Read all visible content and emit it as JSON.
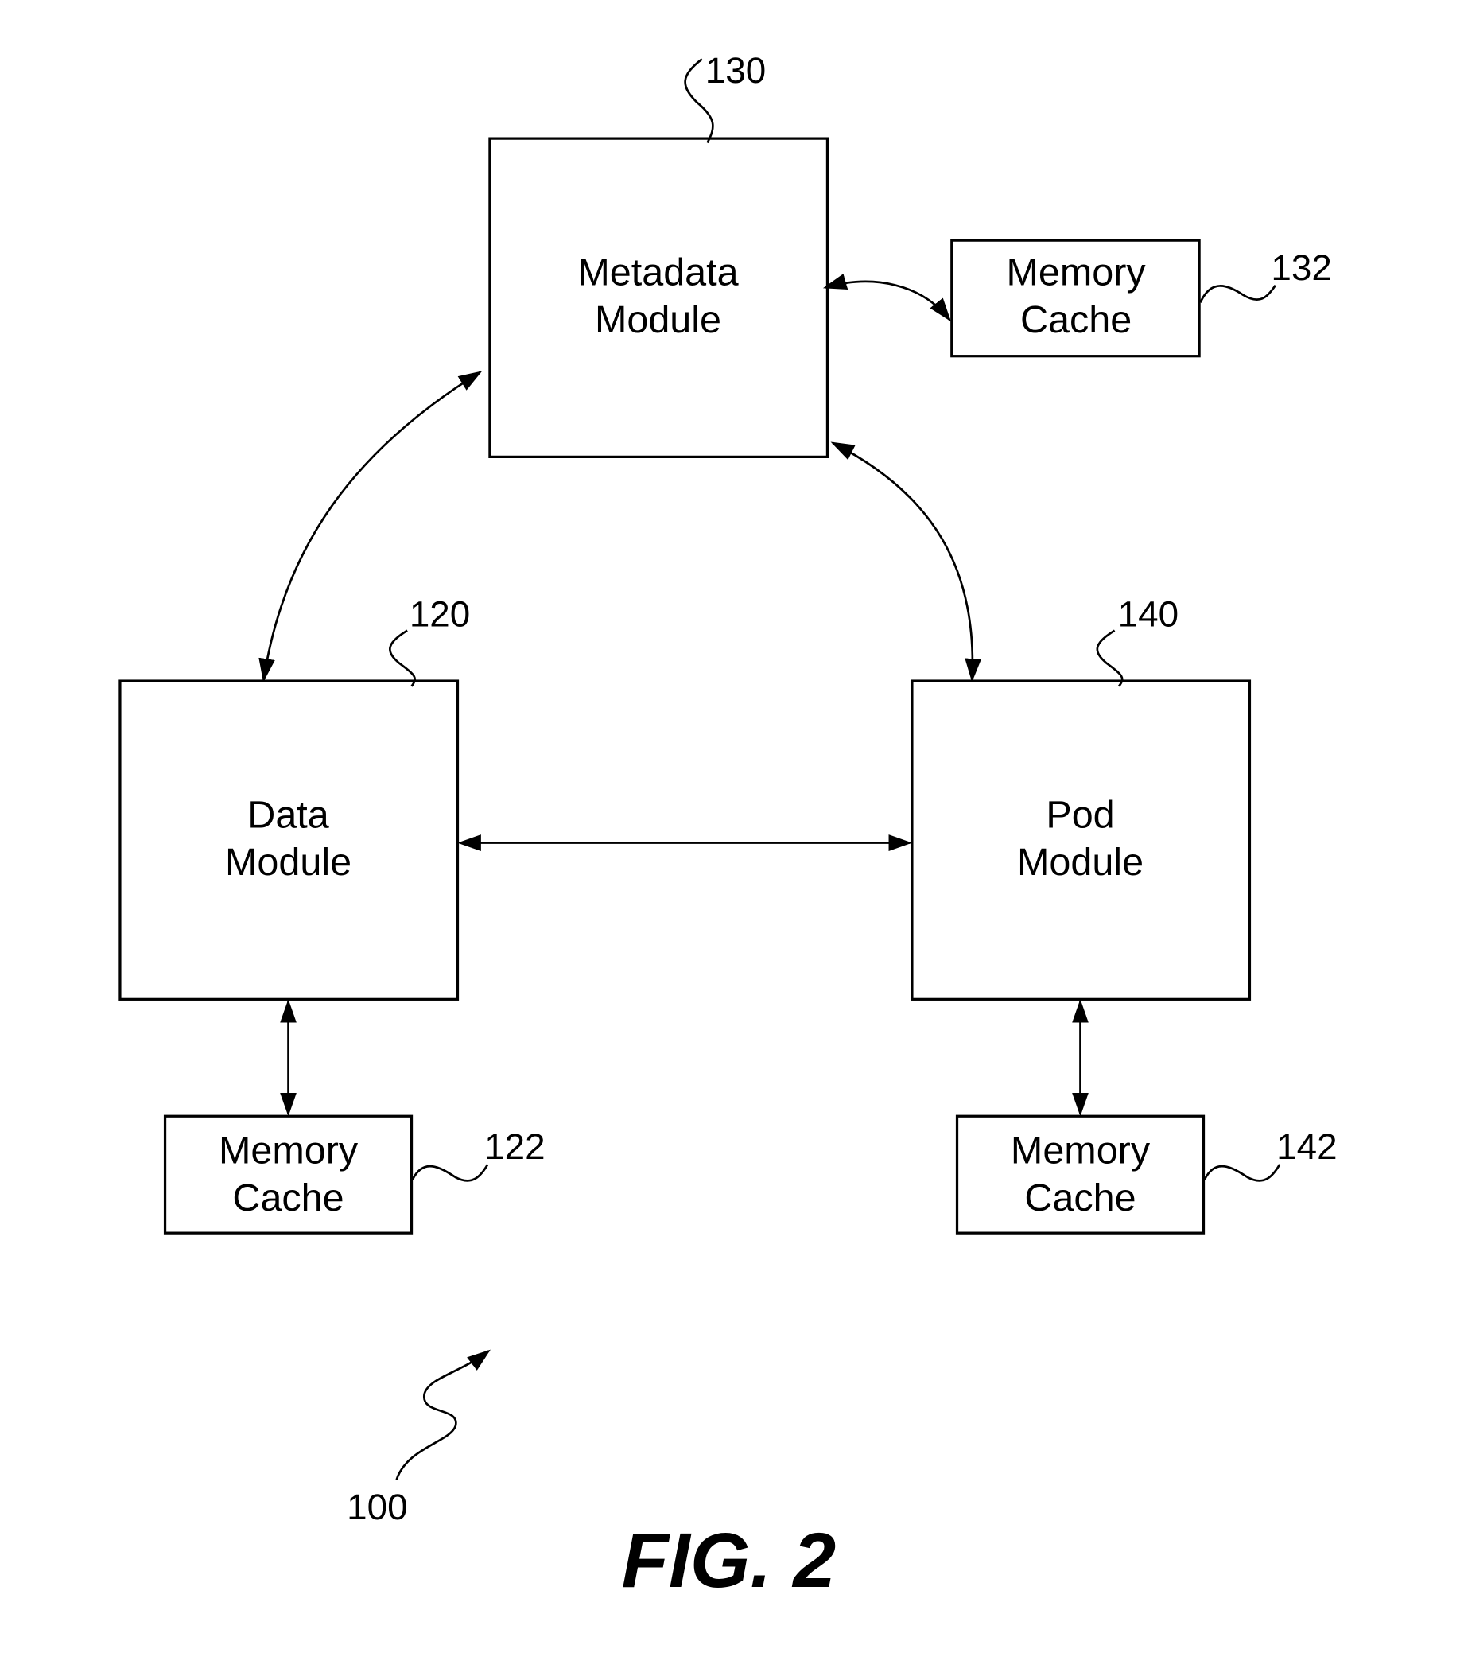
{
  "figure": {
    "caption": "FIG. 2",
    "system_ref": "100",
    "modules": {
      "metadata": {
        "line1": "Metadata",
        "line2": "Module",
        "ref": "130"
      },
      "data": {
        "line1": "Data",
        "line2": "Module",
        "ref": "120"
      },
      "pod": {
        "line1": "Pod",
        "line2": "Module",
        "ref": "140"
      }
    },
    "caches": {
      "metadata_cache": {
        "line1": "Memory",
        "line2": "Cache",
        "ref": "132"
      },
      "data_cache": {
        "line1": "Memory",
        "line2": "Cache",
        "ref": "122"
      },
      "pod_cache": {
        "line1": "Memory",
        "line2": "Cache",
        "ref": "142"
      }
    },
    "connections": [
      {
        "from": "Metadata Module",
        "to": "Memory Cache 132",
        "type": "bidirectional"
      },
      {
        "from": "Metadata Module",
        "to": "Data Module",
        "type": "bidirectional"
      },
      {
        "from": "Metadata Module",
        "to": "Pod Module",
        "type": "bidirectional"
      },
      {
        "from": "Data Module",
        "to": "Pod Module",
        "type": "bidirectional"
      },
      {
        "from": "Data Module",
        "to": "Memory Cache 122",
        "type": "bidirectional"
      },
      {
        "from": "Pod Module",
        "to": "Memory Cache 142",
        "type": "bidirectional"
      }
    ]
  }
}
